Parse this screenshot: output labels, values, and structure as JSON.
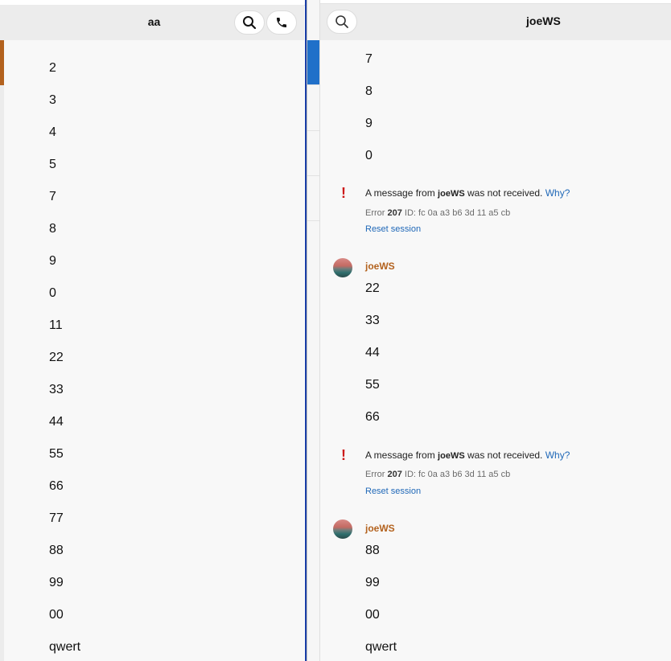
{
  "left": {
    "title": "aa",
    "messages": [
      "2",
      "3",
      "4",
      "5",
      "7",
      "8",
      "9",
      "0",
      "11",
      "22",
      "33",
      "44",
      "55",
      "66",
      "77",
      "88",
      "99",
      "00",
      "qwert"
    ]
  },
  "right": {
    "title": "joeWS",
    "top_messages": [
      "7",
      "8",
      "9",
      "0"
    ],
    "errors": [
      {
        "prefix": "A message from ",
        "sender": "joeWS",
        "suffix": " was not received. ",
        "why": "Why?",
        "error_label": "Error ",
        "error_code": "207",
        "id_text": " ID: fc  0a  a3  b6  3d  11  a5  cb",
        "reset": "Reset session"
      },
      {
        "prefix": "A message from ",
        "sender": "joeWS",
        "suffix": " was not received. ",
        "why": "Why?",
        "error_label": "Error ",
        "error_code": "207",
        "id_text": " ID: fc  0a  a3  b6  3d  11  a5  cb",
        "reset": "Reset session"
      }
    ],
    "groups": [
      {
        "sender": "joeWS",
        "messages": [
          "22",
          "33",
          "44",
          "55",
          "66"
        ]
      },
      {
        "sender": "joeWS",
        "messages": [
          "88",
          "99",
          "00",
          "qwert"
        ]
      }
    ]
  },
  "icons": {
    "search": "search-icon",
    "call": "phone-icon",
    "error": "error-icon",
    "avatar": "avatar"
  },
  "colors": {
    "accent_orange": "#b3621e",
    "active_blue": "#2070c9",
    "link_blue": "#2169b8",
    "error_red": "#cc1a1a"
  }
}
